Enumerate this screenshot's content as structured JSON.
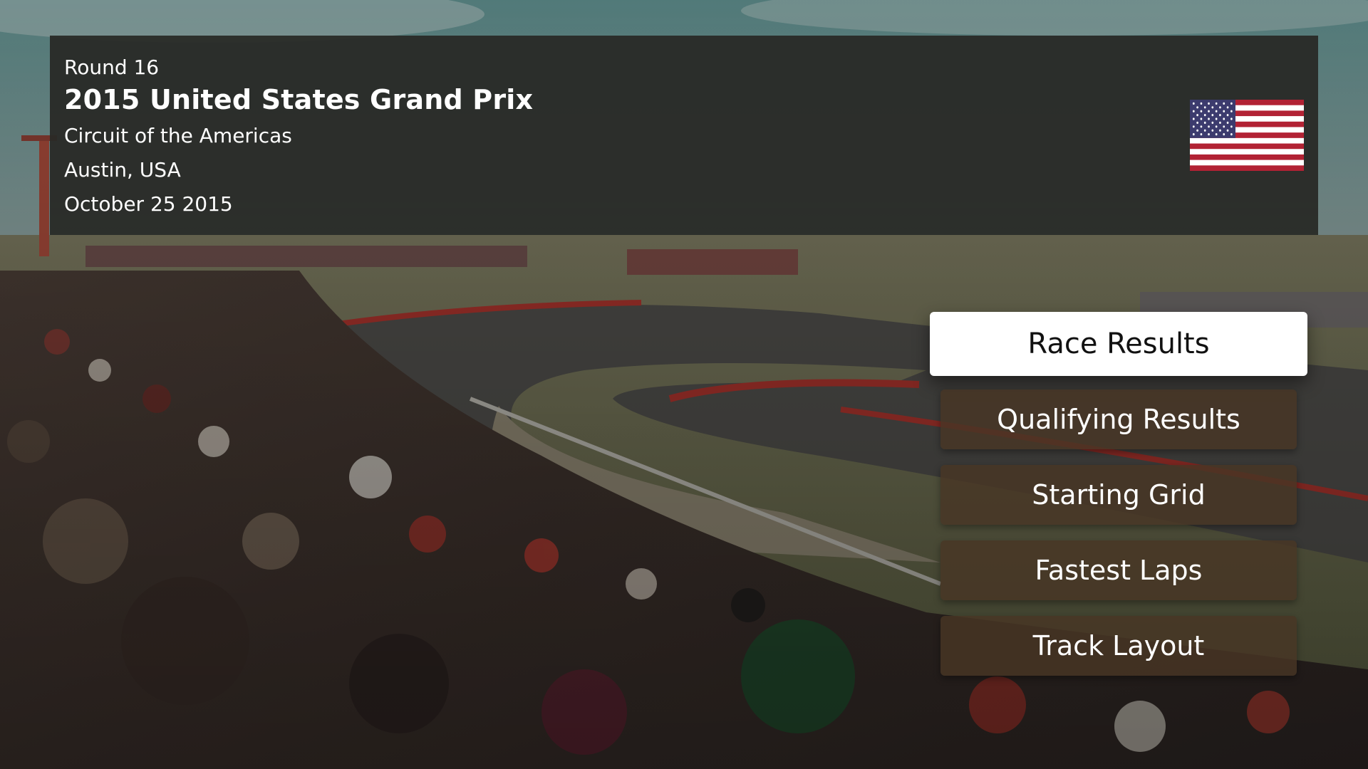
{
  "race": {
    "round": "Round 16",
    "title": "2015 United States Grand Prix",
    "circuit": "Circuit of the Americas",
    "location": "Austin, USA",
    "date": "October 25 2015",
    "flag_icon": "us-flag-icon"
  },
  "menu": {
    "items": [
      {
        "label": "Race Results",
        "focused": true
      },
      {
        "label": "Qualifying Results",
        "focused": false
      },
      {
        "label": "Starting Grid",
        "focused": false
      },
      {
        "label": "Fastest Laps",
        "focused": false
      },
      {
        "label": "Track Layout",
        "focused": false
      }
    ]
  },
  "colors": {
    "panel": "#282926",
    "menu_item": "#483624",
    "menu_focused": "#ffffff",
    "flag_red": "#b22234",
    "flag_blue": "#3c3b6e"
  }
}
